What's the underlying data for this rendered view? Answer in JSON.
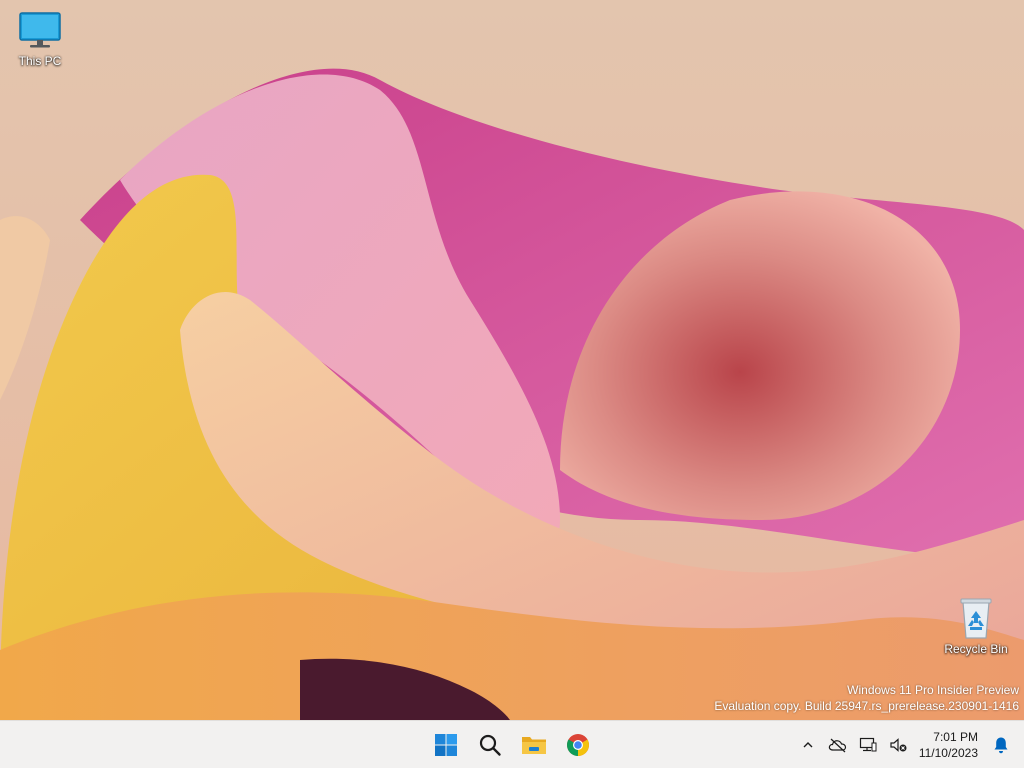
{
  "desktop": {
    "icons": [
      {
        "label": "This PC",
        "icon": "monitor-icon"
      },
      {
        "label": "Recycle Bin",
        "icon": "recycle-bin-icon"
      }
    ],
    "watermark": {
      "line1": "Windows 11 Pro Insider Preview",
      "line2": "Evaluation copy. Build 25947.rs_prerelease.230901-1416"
    }
  },
  "taskbar": {
    "apps": [
      {
        "name": "Start",
        "icon": "windows-logo-icon"
      },
      {
        "name": "Search",
        "icon": "search-icon"
      },
      {
        "name": "File Explorer",
        "icon": "folder-icon"
      },
      {
        "name": "Google Chrome",
        "icon": "chrome-icon"
      }
    ],
    "tray": {
      "icons": [
        "chevron-up-icon",
        "onedrive-offline-icon",
        "network-icon",
        "volume-muted-icon",
        "notification-bell-icon"
      ]
    },
    "clock": {
      "time": "7:01 PM",
      "date": "11/10/2023"
    }
  },
  "colors": {
    "accent": "#0067c0",
    "taskbar_bg": "#f2f1f0",
    "wallpaper_base": "#e2c4ac"
  }
}
